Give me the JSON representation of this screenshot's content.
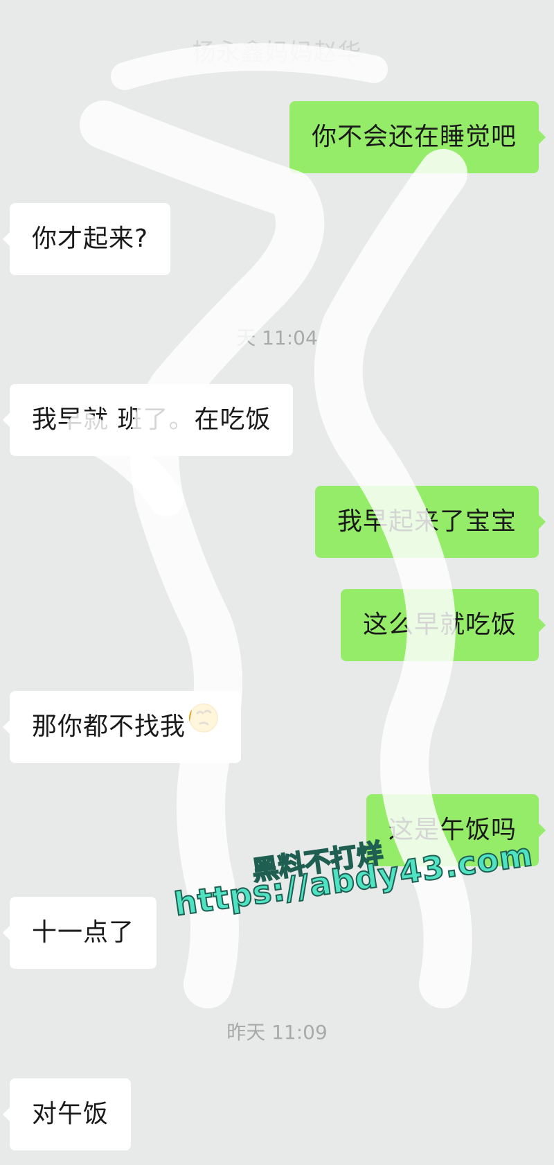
{
  "chat": {
    "title": "杨永鑫妈妈赵华",
    "messages": [
      {
        "side": "out",
        "text": "你不会还在睡觉吧"
      },
      {
        "side": "in",
        "text": "你才起来?"
      },
      {
        "side": "time",
        "text": "天 11:04"
      },
      {
        "side": "in",
        "text": "我早就  班了。在吃饭"
      },
      {
        "side": "out",
        "text": "我早起来了宝宝"
      },
      {
        "side": "out",
        "text": "这么早就吃饭"
      },
      {
        "side": "in",
        "text": "那你都不找我",
        "emoji": "thinking-face-emoji"
      },
      {
        "side": "out",
        "text": "这是午饭吗"
      },
      {
        "side": "in",
        "text": "十一点了"
      },
      {
        "side": "time",
        "text": "昨天 11:09"
      },
      {
        "side": "in",
        "text": "对午饭"
      }
    ]
  },
  "watermark": {
    "line1": "黑料不打烊",
    "line2": "https://abdy43.com"
  },
  "colors": {
    "background": "#e8eae9",
    "incoming_bubble": "#ffffff",
    "outgoing_bubble": "#95ec69",
    "timestamp": "#a8aaa9",
    "watermark_fill": "#4fe3c3",
    "watermark_stroke": "#1f5f52"
  }
}
